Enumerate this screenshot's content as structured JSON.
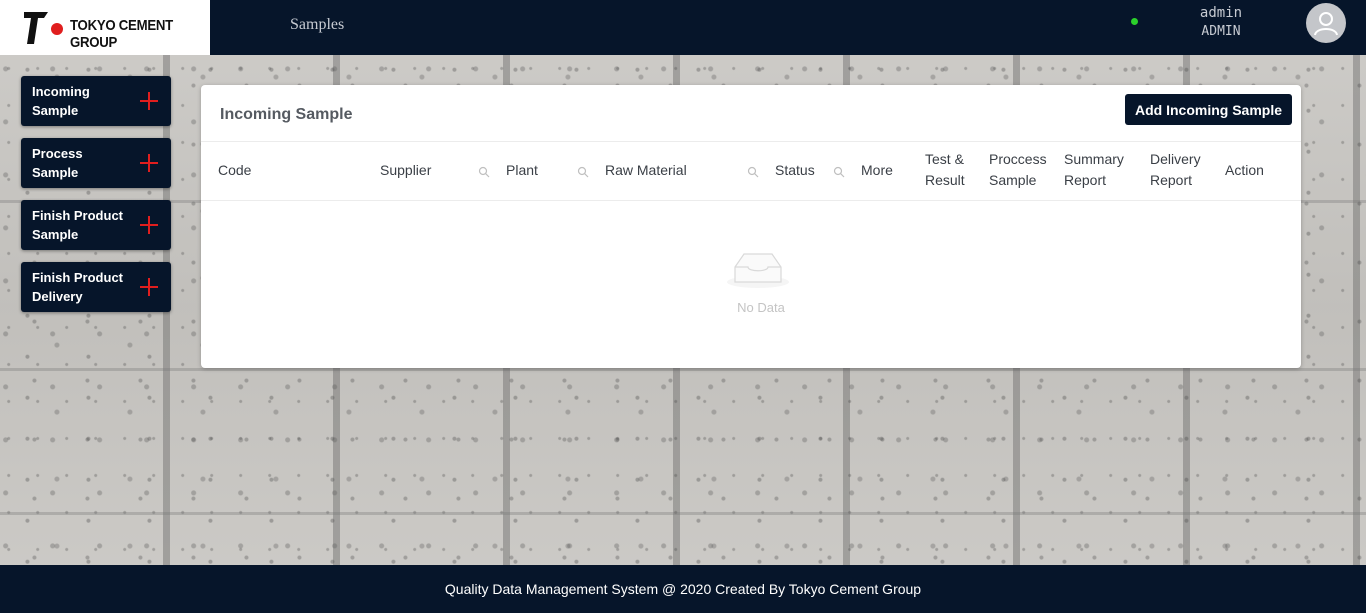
{
  "header": {
    "brand": "TOKYO CEMENT GROUP",
    "nav_item": "Samples",
    "user_name": "admin",
    "user_role": "ADMIN"
  },
  "sidebar": {
    "items": [
      {
        "label": "Incoming Sample",
        "icon": "plus-icon"
      },
      {
        "label": "Process Sample",
        "icon": "plus-icon"
      },
      {
        "label": "Finish Product Sample",
        "icon": "plus-icon"
      },
      {
        "label": "Finish Product Delivery",
        "icon": "plus-icon"
      }
    ]
  },
  "main": {
    "title": "Incoming Sample",
    "add_button": "Add Incoming Sample",
    "columns": [
      {
        "label": "Code"
      },
      {
        "label": "Supplier",
        "searchable": true
      },
      {
        "label": "Plant",
        "searchable": true
      },
      {
        "label": "Raw Material",
        "searchable": true
      },
      {
        "label": "Status",
        "searchable": true
      },
      {
        "label": "More"
      },
      {
        "label": "Test & Result"
      },
      {
        "label": "Proccess Sample"
      },
      {
        "label": "Summary Report"
      },
      {
        "label": "Delivery Report"
      },
      {
        "label": "Action"
      }
    ],
    "empty_text": "No Data"
  },
  "footer": {
    "text": "Quality Data Management System @ 2020 Created By Tokyo Cement Group"
  },
  "colors": {
    "navy": "#06152a",
    "accent_red": "#e01e1e",
    "status_online": "#2bd12b"
  }
}
